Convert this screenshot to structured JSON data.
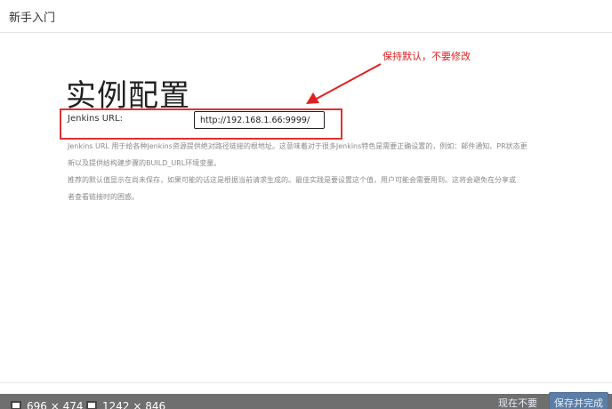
{
  "header": {
    "title": "新手入门"
  },
  "annotation": {
    "text": "保持默认，不要修改",
    "color": "#e02020"
  },
  "main": {
    "title": "实例配置",
    "url_label": "Jenkins URL:",
    "url_value": "http://192.168.1.66:9999/",
    "help_lines": [
      "Jenkins URL 用于给各种Jenkins资源提供绝对路径链接的根地址。这意味着对于很多Jenkins特色是需要正确设置的，例如：邮件通知、PR状态更",
      "新以及提供给构建步骤的BUILD_URL环境变量。",
      "推荐的默认值显示在尚未保存，如果可能的话这是根据当前请求生成的。最佳实践是要设置这个值，用户可能会需要用到。这将会避免在分享或",
      "者查看链接时的困惑。"
    ]
  },
  "status_bar": {
    "size1": "696 × 474",
    "size2": "1242 × 846"
  },
  "footer": {
    "skip_label": "现在不要",
    "save_label": "保存并完成"
  },
  "colors": {
    "accent": "#5b7ea6",
    "annotation_red": "#e02020"
  }
}
